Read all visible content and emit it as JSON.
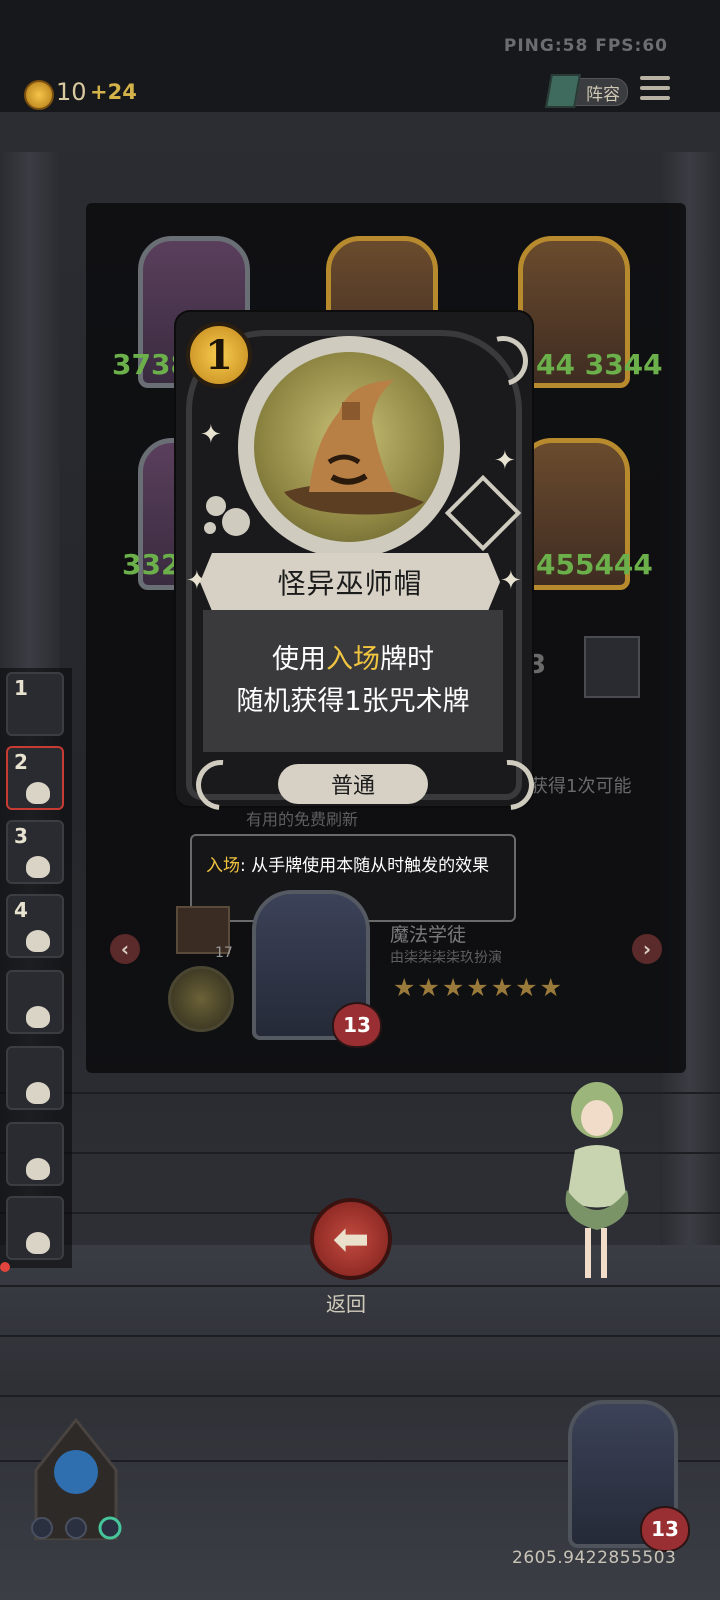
{
  "hud": {
    "ping_fps": "PING:58   FPS:60",
    "coins": "10",
    "coin_bonus": "+24",
    "lineup_label": "阵容"
  },
  "background_cards": [
    {
      "stats": "3738",
      "frame": "silver"
    },
    {
      "stats": "",
      "frame": "gold"
    },
    {
      "stats": "44 3344",
      "frame": "gold"
    },
    {
      "stats": "332",
      "frame": "silver"
    },
    {
      "stats": "455444",
      "frame": "gold"
    }
  ],
  "left_rail": {
    "slots": [
      {
        "num": "1",
        "selected": false
      },
      {
        "num": "2",
        "selected": true
      },
      {
        "num": "3",
        "selected": false
      },
      {
        "num": "4",
        "selected": false
      },
      {
        "num": "",
        "selected": false
      },
      {
        "num": "",
        "selected": false
      },
      {
        "num": "",
        "selected": false
      },
      {
        "num": "",
        "selected": false
      }
    ]
  },
  "card": {
    "cost": "1",
    "name": "怪异巫师帽",
    "desc_line1_pre": "使用",
    "desc_line1_kw": "入场",
    "desc_line1_post": "牌时",
    "desc_line2": "随机获得1张咒术牌",
    "rarity": "普通",
    "art_icon": "wizard-hat-icon"
  },
  "tooltip": {
    "keyword": "入场",
    "text": ": 从手牌使用本随从时触发的效果"
  },
  "panel_bottom": {
    "hero_name": "魔法学徒",
    "hero_sub": "由柒柒柒柒玖扮演",
    "stars": 7,
    "hero_health": "13",
    "item_count": "17",
    "partial_text_left": "有用的免费刷新",
    "partial_text_right": "获得1次可能",
    "right_card_badge": "3"
  },
  "back": {
    "label": "返回"
  },
  "bottom": {
    "hero_health": "13",
    "coords": "2605.9422855503"
  },
  "colors": {
    "keyword": "#f1c540",
    "stat_green": "#6bb04a",
    "back_button": "#b13a32"
  }
}
